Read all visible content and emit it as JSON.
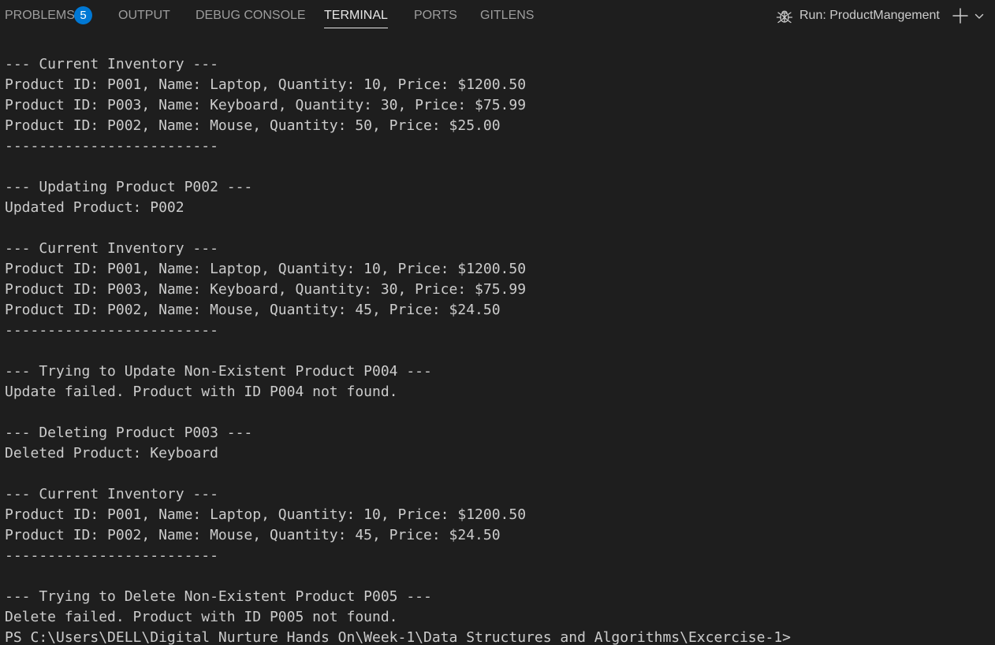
{
  "tabs": {
    "problems": "PROBLEMS",
    "problems_count": "5",
    "output": "OUTPUT",
    "debug_console": "DEBUG CONSOLE",
    "terminal": "TERMINAL",
    "ports": "PORTS",
    "gitlens": "GITLENS"
  },
  "toolbar": {
    "run_label": "Run: ProductMangement",
    "run_icon": "debug-bug-icon",
    "new_terminal_icon": "plus-icon",
    "dropdown_icon": "chevron-down-icon"
  },
  "terminal": {
    "lines": [
      "--- Current Inventory ---",
      "Product ID: P001, Name: Laptop, Quantity: 10, Price: $1200.50",
      "Product ID: P003, Name: Keyboard, Quantity: 30, Price: $75.99",
      "Product ID: P002, Name: Mouse, Quantity: 50, Price: $25.00",
      "-------------------------",
      "",
      "--- Updating Product P002 ---",
      "Updated Product: P002",
      "",
      "--- Current Inventory ---",
      "Product ID: P001, Name: Laptop, Quantity: 10, Price: $1200.50",
      "Product ID: P003, Name: Keyboard, Quantity: 30, Price: $75.99",
      "Product ID: P002, Name: Mouse, Quantity: 45, Price: $24.50",
      "-------------------------",
      "",
      "--- Trying to Update Non-Existent Product P004 ---",
      "Update failed. Product with ID P004 not found.",
      "",
      "--- Deleting Product P003 ---",
      "Deleted Product: Keyboard",
      "",
      "--- Current Inventory ---",
      "Product ID: P001, Name: Laptop, Quantity: 10, Price: $1200.50",
      "Product ID: P002, Name: Mouse, Quantity: 45, Price: $24.50",
      "-------------------------",
      "",
      "--- Trying to Delete Non-Existent Product P005 ---",
      "Delete failed. Product with ID P005 not found.",
      "PS C:\\Users\\DELL\\Digital Nurture Hands On\\Week-1\\Data Structures and Algorithms\\Excercise-1>"
    ]
  }
}
